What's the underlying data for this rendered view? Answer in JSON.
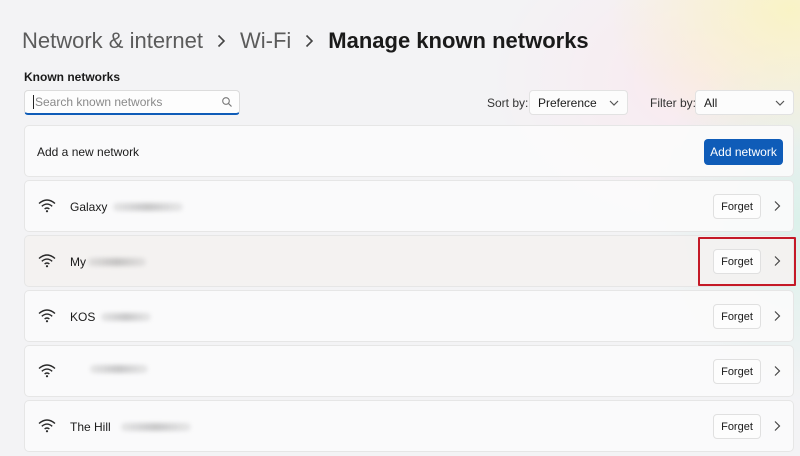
{
  "breadcrumb": {
    "items": [
      "Network & internet",
      "Wi-Fi"
    ],
    "current": "Manage known networks"
  },
  "section_title": "Known networks",
  "search": {
    "placeholder": "Search known networks",
    "icon": "search-icon"
  },
  "sort": {
    "label": "Sort by:",
    "value": "Preference"
  },
  "filter": {
    "label": "Filter by:",
    "value": "All"
  },
  "add_network": {
    "label": "Add a new network",
    "button": "Add network"
  },
  "networks": [
    {
      "name": "Galaxy",
      "forget": "Forget"
    },
    {
      "name": "My",
      "forget": "Forget",
      "highlighted": true
    },
    {
      "name": "KOS",
      "forget": "Forget"
    },
    {
      "name": "",
      "forget": "Forget"
    },
    {
      "name": "The Hill",
      "forget": "Forget"
    }
  ],
  "colors": {
    "accent": "#0f5cb8",
    "highlight_box": "#c41a27"
  }
}
